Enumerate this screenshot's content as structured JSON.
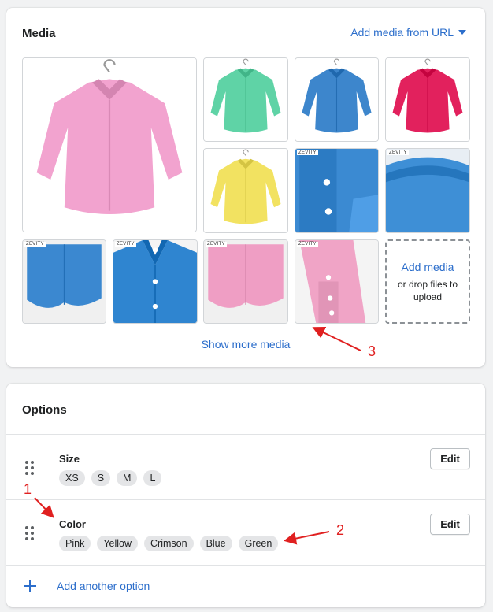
{
  "media": {
    "title": "Media",
    "add_from_url": "Add media from URL",
    "images": [
      {
        "desc": "pink shirt main",
        "shirt_color": "#f2a3cf",
        "badge": ""
      },
      {
        "desc": "green shirt",
        "shirt_color": "#5fd3a6",
        "badge": ""
      },
      {
        "desc": "blue shirt",
        "shirt_color": "#3d86cc",
        "badge": ""
      },
      {
        "desc": "crimson shirt",
        "shirt_color": "#e2215d",
        "badge": ""
      },
      {
        "desc": "yellow shirt",
        "shirt_color": "#f2e261",
        "badge": ""
      },
      {
        "desc": "blue sleeve cuff",
        "shirt_color": "#3b8ad2",
        "badge": "ZEVITY"
      },
      {
        "desc": "blue collar back",
        "shirt_color": "#3e8fd6",
        "badge": "ZEVITY"
      },
      {
        "desc": "blue hem",
        "shirt_color": "#3b88d0",
        "badge": "ZEVITY"
      },
      {
        "desc": "blue collar front",
        "shirt_color": "#2f85d0",
        "badge": "ZEVITY"
      },
      {
        "desc": "pink hem",
        "shirt_color": "#ef9ec4",
        "badge": "ZEVITY"
      },
      {
        "desc": "pink cuff",
        "shirt_color": "#f0a4c6",
        "badge": "ZEVITY"
      }
    ],
    "drop_zone": {
      "title": "Add media",
      "subtitle": "or drop files to upload"
    },
    "show_more": "Show more media"
  },
  "options": {
    "title": "Options",
    "rows": [
      {
        "name": "Size",
        "values": [
          "XS",
          "S",
          "M",
          "L"
        ],
        "edit_label": "Edit"
      },
      {
        "name": "Color",
        "values": [
          "Pink",
          "Yellow",
          "Crimson",
          "Blue",
          "Green"
        ],
        "edit_label": "Edit"
      }
    ],
    "add_option": "Add another option"
  },
  "annotations": {
    "one": "1",
    "two": "2",
    "three": "3",
    "color": "#e02020"
  },
  "colors": {
    "accent": "#2c6ecb",
    "background": "#f1f2f3"
  }
}
